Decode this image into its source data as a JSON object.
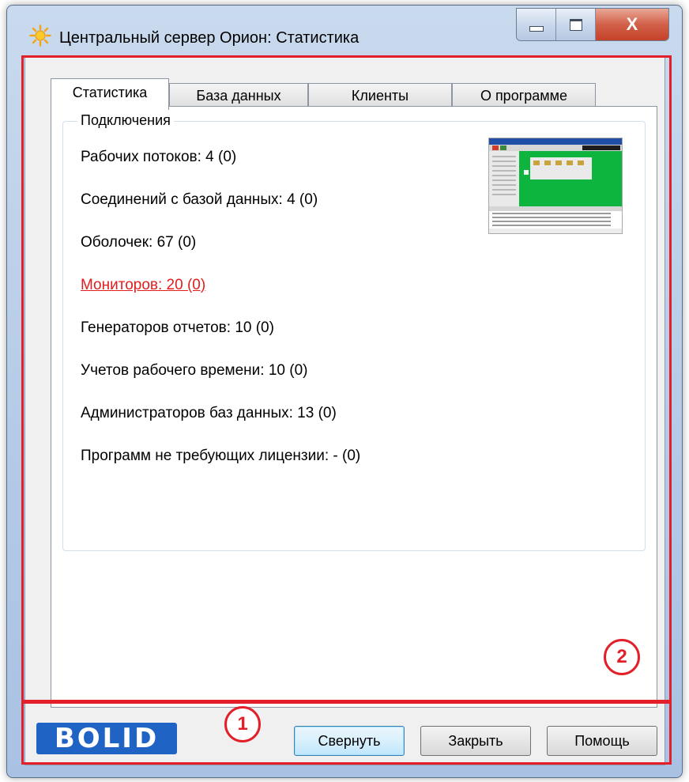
{
  "window": {
    "title": "Центральный сервер Орион: Статистика",
    "close_glyph": "X"
  },
  "tabs": [
    {
      "label": "Статистика",
      "active": true
    },
    {
      "label": "База данных",
      "active": false
    },
    {
      "label": "Клиенты",
      "active": false
    },
    {
      "label": "О программе",
      "active": false
    }
  ],
  "connections": {
    "group_title": "Подключения",
    "items": [
      {
        "text": "Рабочих потоков: 4 (0)"
      },
      {
        "text": "Соединений с базой данных: 4 (0)"
      },
      {
        "text": "Оболочек: 67 (0)"
      },
      {
        "text": "Мониторов: 20 (0)",
        "highlight": true
      },
      {
        "text": "Генераторов отчетов: 10 (0)"
      },
      {
        "text": "Учетов рабочего времени: 10 (0)"
      },
      {
        "text": "Администраторов баз данных: 13 (0)"
      },
      {
        "text": "Программ не требующих лицензии: - (0)"
      }
    ]
  },
  "footer": {
    "logo_text": "BOLID",
    "buttons": {
      "minimize": "Свернуть",
      "close": "Закрыть",
      "help": "Помощь"
    }
  },
  "callouts": {
    "one": "1",
    "two": "2"
  },
  "colors": {
    "accent_red": "#e3202a",
    "highlight_text": "#e01e1e",
    "logo_blue": "#1f63c4"
  }
}
